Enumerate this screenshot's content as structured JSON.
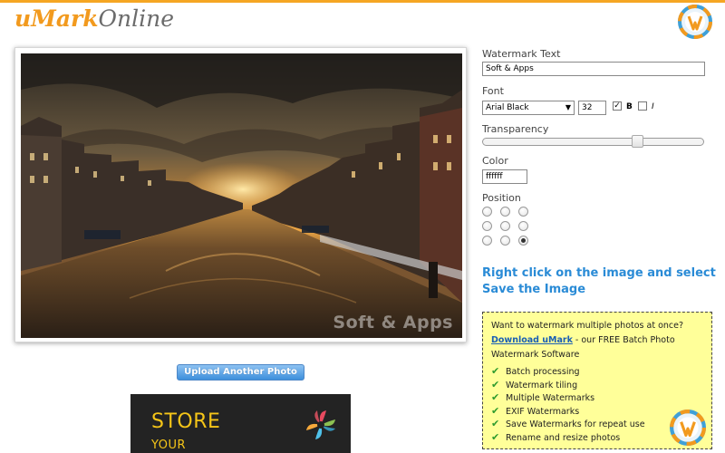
{
  "header": {
    "logo_part1": "uMark",
    "logo_part2": "Online",
    "badge_icon": "umark-logo-icon"
  },
  "photo": {
    "watermark_text": "Soft & Apps"
  },
  "upload_button_label": "Upload Another Photo",
  "ad": {
    "line1": "STORE",
    "line2": "YOUR",
    "icon": "colorful-swirl-icon"
  },
  "controls": {
    "watermark_text_label": "Watermark Text",
    "watermark_text_value": "Soft & Apps",
    "font_label": "Font",
    "font_value": "Arial Black",
    "font_size": "32",
    "bold_label": "B",
    "bold_checked": true,
    "italic_label": "I",
    "italic_checked": false,
    "transparency_label": "Transparency",
    "transparency_level": 0.7,
    "color_label": "Color",
    "color_value": "ffffff",
    "position_label": "Position",
    "position_selected": "bottom-right"
  },
  "instruction": "Right click on the image and select Save the Image",
  "promo": {
    "line1": "Want to watermark multiple photos at once?",
    "link_text": "Download uMark",
    "line2_rest": " - our FREE Batch Photo",
    "line3": "Watermark Software",
    "features": [
      "Batch processing",
      "Watermark tiling",
      "Multiple Watermarks",
      "EXIF Watermarks",
      "Save Watermarks for repeat use",
      "Rename and resize photos"
    ]
  },
  "colors": {
    "accent_orange": "#f5a623",
    "link_blue": "#2a8bd6",
    "promo_bg": "#ffff99"
  }
}
